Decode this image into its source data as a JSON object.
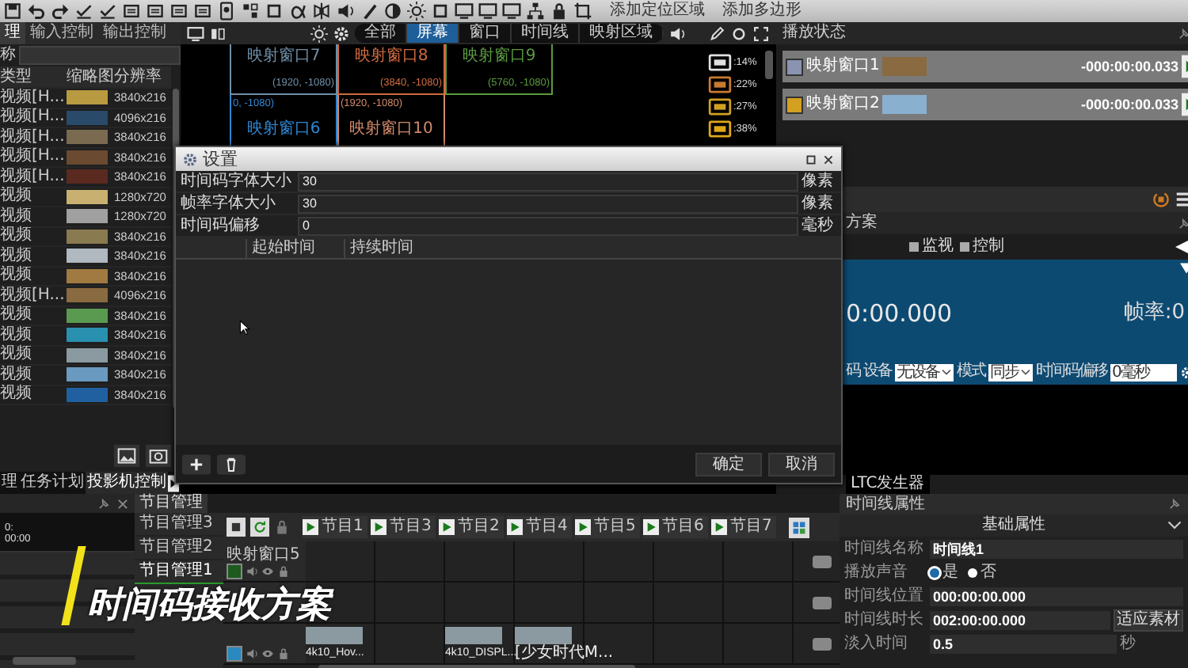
{
  "toolbar": {
    "texts": [
      "添加定位区域",
      "添加多边形"
    ]
  },
  "media_panel": {
    "tabs": [
      {
        "label": "理",
        "selected": true
      },
      {
        "label": "输入控制",
        "selected": false
      },
      {
        "label": "输出控制",
        "selected": false
      }
    ],
    "search_label": "称",
    "columns": [
      "类型",
      "缩略图",
      "分辨率"
    ],
    "rows": [
      {
        "type": "视频[H...",
        "resolution": "3840x216"
      },
      {
        "type": "视频[H...",
        "resolution": "4096x216"
      },
      {
        "type": "视频[H...",
        "resolution": "3840x216"
      },
      {
        "type": "视频[H...",
        "resolution": "3840x216"
      },
      {
        "type": "视频[H...",
        "resolution": "3840x216"
      },
      {
        "type": "视频",
        "resolution": "1280x720"
      },
      {
        "type": "视频",
        "resolution": "1280x720"
      },
      {
        "type": "视频",
        "resolution": "3840x216"
      },
      {
        "type": "视频",
        "resolution": "3840x216"
      },
      {
        "type": "视频",
        "resolution": "3840x216"
      },
      {
        "type": "视频[H...",
        "resolution": "4096x216"
      },
      {
        "type": "视频",
        "resolution": "3840x216"
      },
      {
        "type": "视频",
        "resolution": "3840x216"
      },
      {
        "type": "视频",
        "resolution": "3840x216"
      },
      {
        "type": "视频",
        "resolution": "3840x216"
      },
      {
        "type": "视频",
        "resolution": "3840x216"
      }
    ],
    "bottom_tabs": [
      {
        "label": "理",
        "selected": false
      },
      {
        "label": "任务计划",
        "selected": false
      },
      {
        "label": "投影机控制",
        "selected": true
      }
    ]
  },
  "view_bar": {
    "segments": [
      {
        "label": "全部",
        "selected": false
      },
      {
        "label": "屏幕",
        "selected": true
      },
      {
        "label": "窗口",
        "selected": false
      },
      {
        "label": "时间线",
        "selected": false
      },
      {
        "label": "映射区域",
        "selected": false
      }
    ]
  },
  "canvas": {
    "windows": [
      {
        "name": "映射窗口7",
        "coord": "(1920, -1080)",
        "color": "#6f8fa8"
      },
      {
        "name": "映射窗口8",
        "coord": "(3840, -1080)",
        "color": "#d06a40"
      },
      {
        "name": "映射窗口9",
        "coord": "(5760, -1080)",
        "color": "#5a9a40"
      },
      {
        "name": "映射窗口6",
        "coord": "0, -1080)",
        "color": "#2f86d0"
      },
      {
        "name": "映射窗口10",
        "coord": "(1920, -1080)",
        "color": "#d08a6a"
      }
    ],
    "usage": [
      {
        "text": ":14%",
        "color": "#e0e0e0"
      },
      {
        "text": ":22%",
        "color": "#c87a30"
      },
      {
        "text": ":27%",
        "color": "#d0a020"
      },
      {
        "text": ":38%",
        "color": "#e0a818"
      }
    ]
  },
  "dialog": {
    "title": "设置",
    "fields": [
      {
        "label": "时间码字体大小",
        "value": "30",
        "unit": "像素"
      },
      {
        "label": "帧率字体大小",
        "value": "30",
        "unit": "像素"
      },
      {
        "label": "时间码偏移",
        "value": "0",
        "unit": "毫秒"
      }
    ],
    "columns": [
      "起始时间",
      "持续时间"
    ],
    "buttons": [
      "确定",
      "取消"
    ]
  },
  "playback": {
    "title": "播放状态",
    "items": [
      {
        "name": "映射窗口1",
        "time": "-000:00:00.033",
        "color": "#8a94b0"
      },
      {
        "name": "映射窗口2",
        "time": "-000:00:00.033",
        "color": "#d4a020"
      }
    ]
  },
  "receiver": {
    "title": "方案",
    "options": [
      {
        "label": "监视",
        "checked": false
      },
      {
        "label": "控制",
        "checked": false
      }
    ],
    "time": "0:00.000",
    "framerate": "帧率:0",
    "prefix": "码",
    "device_label": "设备",
    "device": "无设备",
    "mode_label": "模式",
    "mode": "同步",
    "offset_label": "时间码偏移",
    "offset": "0毫秒",
    "tab": "LTC发生器"
  },
  "properties": {
    "title": "时间线属性",
    "section": "基础属性",
    "name_label": "时间线名称",
    "name": "时间线1",
    "sound_label": "播放声音",
    "sound_options": [
      {
        "label": "是",
        "selected": true
      },
      {
        "label": "否",
        "selected": false
      }
    ],
    "position_label": "时间线位置",
    "position": "000:00:00.000",
    "duration_label": "时间线时长",
    "duration": "002:00:00.000",
    "fit_button": "适应素材",
    "fade_label": "淡入时间",
    "fade": "0.5",
    "fade_unit": "秒"
  },
  "timeline": {
    "ruler": [
      "0:",
      "00:00"
    ]
  },
  "programs": {
    "tab": "节目管理",
    "lists": [
      {
        "label": "节目管理3",
        "selected": false
      },
      {
        "label": "节目管理2",
        "selected": false
      },
      {
        "label": "节目管理1",
        "selected": true
      }
    ],
    "programs": [
      "节目1",
      "节目3",
      "节目2",
      "节目4",
      "节目5",
      "节目6",
      "节目7"
    ],
    "tracks": [
      {
        "kind": "track",
        "name": "映射窗口5",
        "color": "#1e5a1e"
      },
      {
        "kind": "covered"
      },
      {
        "kind": "track",
        "color": "#2a8ac0",
        "cells": [
          {
            "kind": "clip",
            "label": "4k10_Hov..."
          },
          {
            "kind": "empty"
          },
          {
            "kind": "clip",
            "label": "4k10_DISPL..."
          },
          {
            "kind": "clip",
            "label": "[少女时代M..."
          }
        ]
      }
    ]
  },
  "caption": {
    "text": "时间码接收方案"
  }
}
